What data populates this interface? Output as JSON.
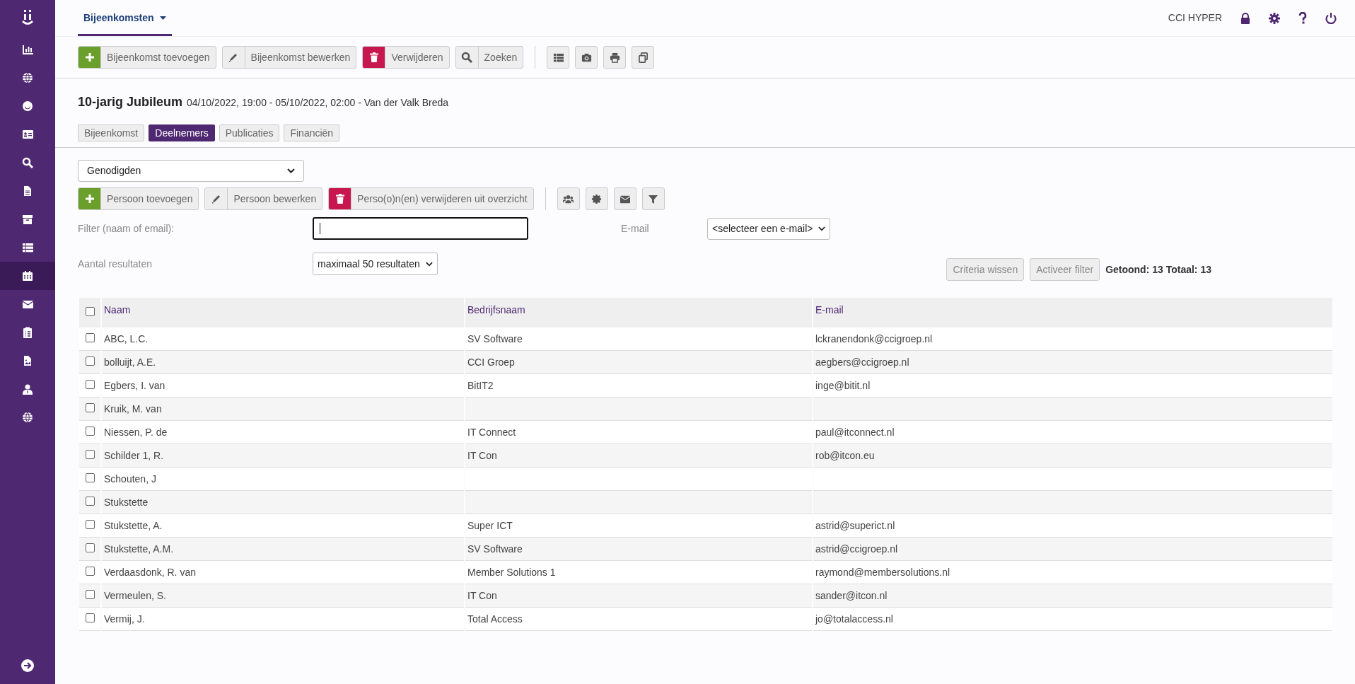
{
  "sidebar": {
    "items": [
      {
        "kind": "chart",
        "selected": false
      },
      {
        "kind": "globe",
        "selected": false
      },
      {
        "kind": "circle",
        "selected": false
      },
      {
        "kind": "card",
        "selected": false
      },
      {
        "kind": "search",
        "selected": false
      },
      {
        "kind": "file",
        "selected": false
      },
      {
        "kind": "archive",
        "selected": false
      },
      {
        "kind": "list",
        "selected": false
      },
      {
        "kind": "calendar",
        "selected": true
      },
      {
        "kind": "envelope",
        "selected": false
      },
      {
        "kind": "clipboard",
        "selected": false
      },
      {
        "kind": "image-file",
        "selected": false
      },
      {
        "kind": "user",
        "selected": false
      },
      {
        "kind": "globe",
        "selected": false
      }
    ]
  },
  "top_nav": {
    "tabs": [
      {
        "label": "Bijeenkomsten",
        "selected": true
      }
    ],
    "user": "CCI HYPER"
  },
  "toolbar": {
    "buttons": [
      {
        "label": "Bijeenkomst toevoegen",
        "kind": "add"
      },
      {
        "label": "Bijeenkomst bewerken",
        "kind": "edit"
      },
      {
        "label": "Verwijderen",
        "kind": "delete"
      },
      {
        "label": "Zoeken",
        "kind": "search"
      }
    ],
    "icon_buttons": [
      {
        "kind": "list"
      },
      {
        "kind": "camera"
      },
      {
        "kind": "print"
      },
      {
        "kind": "copy"
      }
    ]
  },
  "event": {
    "title": "10-jarig Jubileum",
    "details": "04/10/2022, 19:00 - 05/10/2022, 02:00 - Van der Valk Breda"
  },
  "sub_tabs": [
    {
      "label": "Bijeenkomst",
      "selected": false
    },
    {
      "label": "Deelnemers",
      "selected": true
    },
    {
      "label": "Publicaties",
      "selected": false
    },
    {
      "label": "Financiën",
      "selected": false
    }
  ],
  "list_select": {
    "value": "Genodigden"
  },
  "person_toolbar": {
    "buttons": [
      {
        "label": "Persoon toevoegen",
        "kind": "add"
      },
      {
        "label": "Persoon bewerken",
        "kind": "edit"
      },
      {
        "label": "Perso(o)n(en) verwijderen uit overzicht",
        "kind": "delete"
      }
    ],
    "icon_buttons": [
      {
        "kind": "users"
      },
      {
        "kind": "badge"
      },
      {
        "kind": "envelope"
      },
      {
        "kind": "filter"
      }
    ]
  },
  "filters": {
    "name_label": "Filter (naam of email):",
    "name_focused": true,
    "email_label": "E-mail",
    "email_select": "<selecteer een e-mail>",
    "results_label": "Aantal resultaten",
    "results_select": "maximaal 50 resultaten",
    "buttons": [
      "Criteria wissen",
      "Activeer filter"
    ],
    "summary": "Getoond: 13 Totaal: 13"
  },
  "table": {
    "select_all_checked": false,
    "columns": [
      "Naam",
      "Bedrijfsnaam",
      "E-mail"
    ],
    "rows": [
      {
        "checked": false,
        "name": "ABC, L.C.",
        "company": "SV Software",
        "email": "lckranendonk@ccigroep.nl"
      },
      {
        "checked": false,
        "name": "bolluijt, A.E.",
        "company": "CCI Groep",
        "email": "aegbers@ccigroep.nl"
      },
      {
        "checked": false,
        "name": "Egbers, I. van",
        "company": "BitIT2",
        "email": "inge@bitit.nl"
      },
      {
        "checked": false,
        "name": "Kruik, M. van"
      },
      {
        "checked": false,
        "name": "Niessen, P. de",
        "company": "IT Connect",
        "email": "paul@itconnect.nl"
      },
      {
        "checked": false,
        "name": "Schilder 1, R.",
        "company": "IT Con",
        "email": "rob@itcon.eu"
      },
      {
        "checked": false,
        "name": "Schouten, J"
      },
      {
        "checked": false,
        "name": "Stukstette"
      },
      {
        "checked": false,
        "name": "Stukstette, A.",
        "company": "Super ICT",
        "email": "astrid@superict.nl"
      },
      {
        "checked": false,
        "name": "Stukstette, A.M.",
        "company": "SV Software",
        "email": "astrid@ccigroep.nl"
      },
      {
        "checked": false,
        "name": "Verdaasdonk, R. van",
        "company": "Member Solutions 1",
        "email": "raymond@membersolutions.nl"
      },
      {
        "checked": false,
        "name": "Vermeulen, S.",
        "company": "IT Con",
        "email": "sander@itcon.nl"
      },
      {
        "checked": false,
        "name": "Vermij, J.",
        "company": "Total Access",
        "email": "jo@totalaccess.nl"
      }
    ]
  }
}
